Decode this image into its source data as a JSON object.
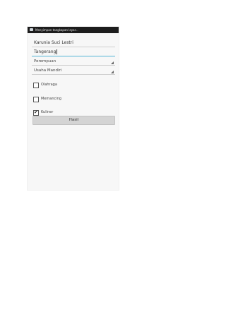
{
  "status_bar": {
    "notification": "Menyimpan tangkapan layar..."
  },
  "form": {
    "name_value": "Karunia Suci Lestri",
    "city_value": "Tangerang",
    "gender_value": "Perempuan",
    "age_group_value": "Usaha Mandiri"
  },
  "hobbies": [
    {
      "label": "Olahraga",
      "checked": false
    },
    {
      "label": "Memancing",
      "checked": false
    },
    {
      "label": "Kuliner",
      "checked": true
    }
  ],
  "result_button": {
    "label": "Hasil"
  }
}
